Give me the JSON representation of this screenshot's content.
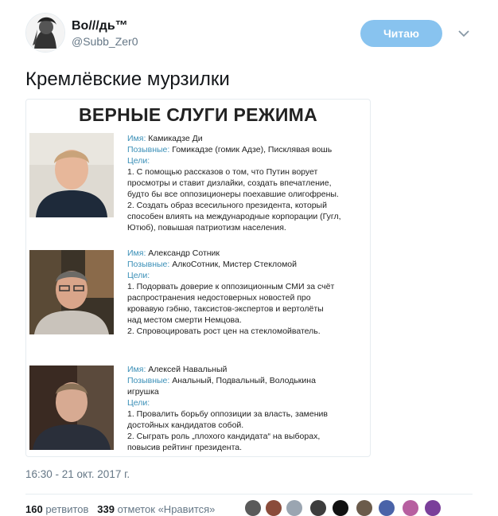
{
  "user": {
    "name": "Во///дь™",
    "handle": "@Subb_Zer0"
  },
  "follow_label": "Читаю",
  "tweet_text": "Кремлёвские мурзилки",
  "card": {
    "title": "ВЕРНЫЕ СЛУГИ РЕЖИМА",
    "entries": [
      {
        "name_key": "Имя:",
        "name": "Камикадзе Ди",
        "nick_key": "Позывные:",
        "nicks": "Гомикадзе (гомик Адзе), Писклявая вошь",
        "goals_key": "Цели:",
        "goals": [
          "1. С помощью рассказов о том, что Путин ворует",
          "просмотры и ставит дизлайки, создать впечатление,",
          "будто бы все оппозиционеры поехавшие олигофрены.",
          "2. Создать образ всесильного президента, который",
          "способен влиять на международные корпорации (Гугл,",
          "Ютюб), повышая патриотизм населения."
        ]
      },
      {
        "name_key": "Имя:",
        "name": "Александр Сотник",
        "nick_key": "Позывные:",
        "nicks": "АлкоСотник, Мистер Стекломой",
        "goals_key": "Цели:",
        "goals": [
          "1. Подорвать доверие к оппозиционным СМИ за счёт",
          "распространения недостоверных новостей про",
          "кровавую гэбню, таксистов-экспертов и вертолёты",
          "над местом смерти Немцова.",
          "2. Спровоцировать рост цен на стекломойватель."
        ]
      },
      {
        "name_key": "Имя:",
        "name": "Алексей Навальный",
        "nick_key": "Позывные:",
        "nicks": "Анальный, Подвальный, Володькина",
        "nicks2": "игрушка",
        "goals_key": "Цели:",
        "goals": [
          "1. Провалить борьбу оппозиции за власть, заменив",
          "достойных кандидатов собой.",
          "2. Сыграть роль „плохого кандидата“ на выборах,",
          "повысив рейтинг президента."
        ]
      }
    ]
  },
  "timestamp": "16:30 - 21 окт. 2017 г.",
  "stats": {
    "retweets_count": "160",
    "retweets_label": "ретвитов",
    "likes_count": "339",
    "likes_label": "отметок «Нравится»"
  },
  "colors": {
    "follow_bg": "#88c3ef",
    "key_color": "#3a8fb7",
    "muted": "#657786"
  }
}
